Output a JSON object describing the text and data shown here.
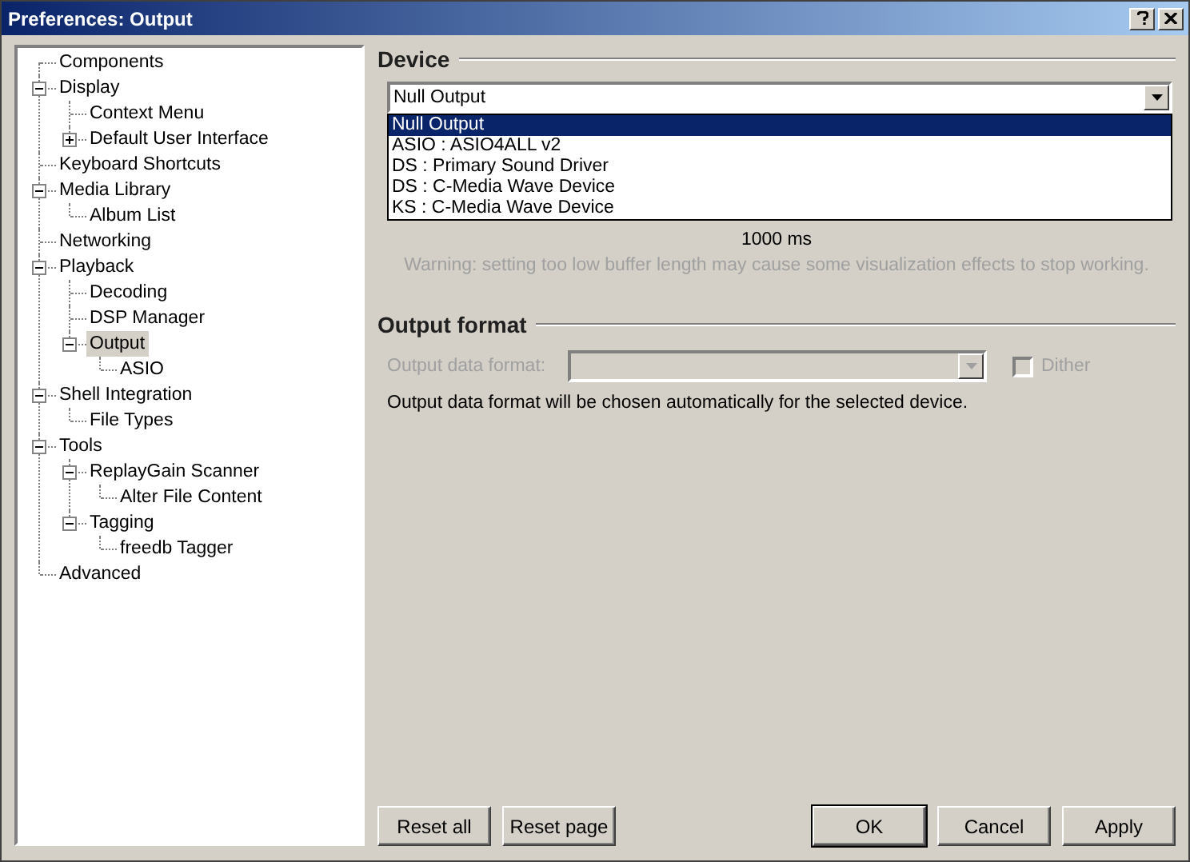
{
  "window": {
    "title": "Preferences: Output",
    "buttons": [
      {
        "kind": "help"
      },
      {
        "kind": "close"
      }
    ]
  },
  "tree": [
    {
      "label": "Components",
      "selected": false
    },
    {
      "label": "Display",
      "selected": false,
      "expanded": true,
      "children": [
        {
          "label": "Context Menu",
          "selected": false
        },
        {
          "label": "Default User Interface",
          "selected": false,
          "expanded": false
        }
      ]
    },
    {
      "label": "Keyboard Shortcuts",
      "selected": false
    },
    {
      "label": "Media Library",
      "selected": false,
      "expanded": true,
      "children": [
        {
          "label": "Album List",
          "selected": false
        }
      ]
    },
    {
      "label": "Networking",
      "selected": false
    },
    {
      "label": "Playback",
      "selected": false,
      "expanded": true,
      "children": [
        {
          "label": "Decoding",
          "selected": false
        },
        {
          "label": "DSP Manager",
          "selected": false
        },
        {
          "label": "Output",
          "selected": true,
          "expanded": true,
          "children": [
            {
              "label": "ASIO",
              "selected": false
            }
          ]
        }
      ]
    },
    {
      "label": "Shell Integration",
      "selected": false,
      "expanded": true,
      "children": [
        {
          "label": "File Types",
          "selected": false
        }
      ]
    },
    {
      "label": "Tools",
      "selected": false,
      "expanded": true,
      "children": [
        {
          "label": "ReplayGain Scanner",
          "selected": false,
          "expanded": true,
          "children": [
            {
              "label": "Alter File Content",
              "selected": false
            }
          ]
        },
        {
          "label": "Tagging",
          "selected": false,
          "expanded": true,
          "children": [
            {
              "label": "freedb Tagger",
              "selected": false
            }
          ]
        }
      ]
    },
    {
      "label": "Advanced",
      "selected": false
    }
  ],
  "device": {
    "heading": "Device",
    "value": "Null Output",
    "options": [
      {
        "label": "Null Output",
        "selected": true
      },
      {
        "label": "ASIO : ASIO4ALL v2",
        "selected": false
      },
      {
        "label": "DS : Primary Sound Driver",
        "selected": false
      },
      {
        "label": "DS : C-Media Wave Device",
        "selected": false
      },
      {
        "label": "KS : C-Media Wave Device",
        "selected": false
      }
    ]
  },
  "buffer": {
    "reading": "1000 ms",
    "warning": "Warning: setting too low buffer length may cause some visualization effects to stop working."
  },
  "output_format": {
    "heading": "Output format",
    "label": "Output data format:",
    "disabled": true,
    "dither": {
      "label": "Dither",
      "checked": false,
      "disabled": true
    },
    "note": "Output data format will be chosen automatically for the selected device."
  },
  "buttons": [
    {
      "label": "Reset all",
      "default": false
    },
    {
      "label": "Reset page",
      "default": false
    },
    {
      "label": "OK",
      "default": true
    },
    {
      "label": "Cancel",
      "default": false
    },
    {
      "label": "Apply",
      "default": false
    }
  ]
}
